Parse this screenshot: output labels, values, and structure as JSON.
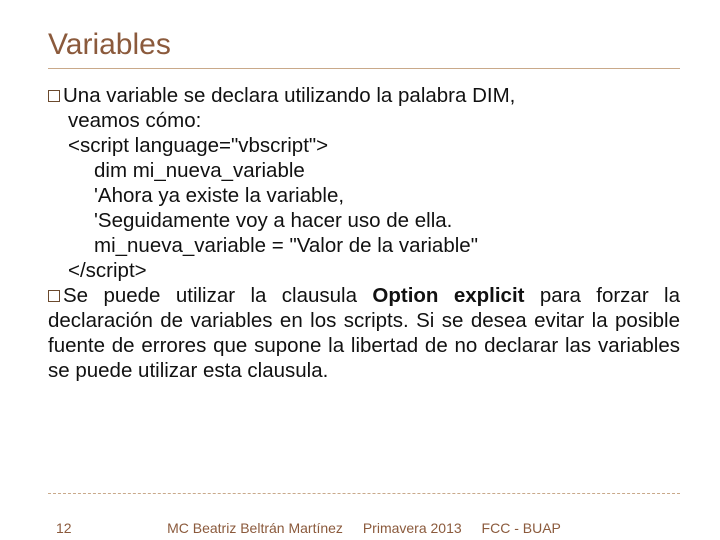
{
  "title": "Variables",
  "para1_lead": "Una variable se declara utilizando la palabra DIM, ",
  "para1_rest": "veamos cómo:",
  "code": {
    "l1": "<script language=\"vbscript\">",
    "l2": "dim mi_nueva_variable",
    "l3": "'Ahora ya existe la variable,",
    "l4": "'Seguidamente voy a hacer uso de ella.",
    "l5": "mi_nueva_variable = \"Valor de la variable\"",
    "l6": "</script>"
  },
  "para2_a": "Se puede utilizar la clausula ",
  "para2_bold": "Option explicit",
  "para2_b": " para forzar la declaración de variables en los scripts. Si se desea evitar la posible fuente de errores que supone la libertad de no declarar las variables se puede utilizar esta clausula.",
  "footer": {
    "page": "12",
    "author": "MC Beatriz Beltrán Martínez",
    "term": "Primavera 2013",
    "org": "FCC - BUAP"
  }
}
